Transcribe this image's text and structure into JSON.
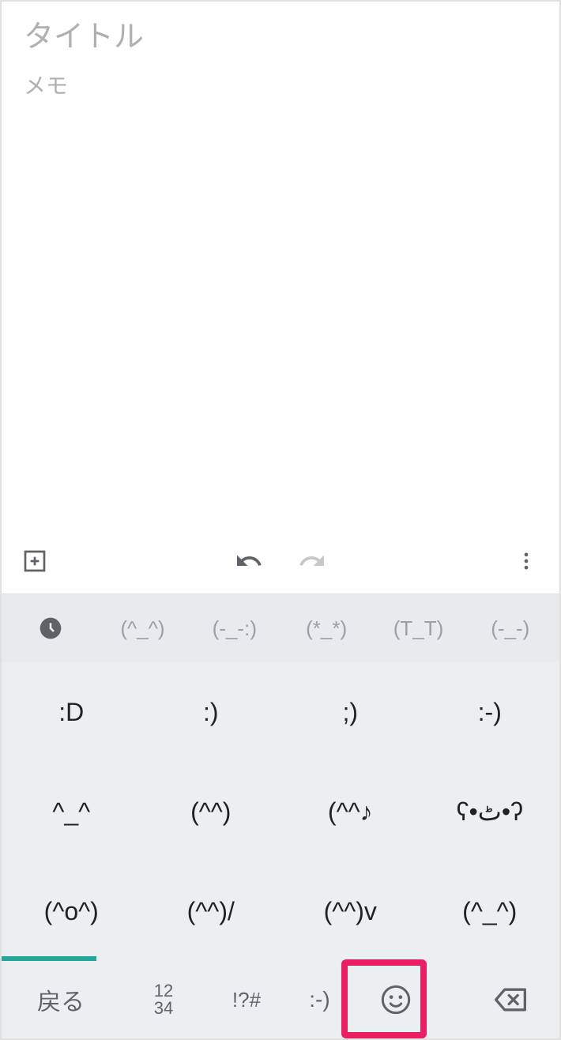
{
  "note": {
    "title_placeholder": "タイトル",
    "title_value": "",
    "memo_placeholder": "メモ",
    "memo_value": ""
  },
  "toolbar": {
    "add_label": "add",
    "undo_label": "undo",
    "redo_label": "redo",
    "more_label": "more"
  },
  "kaomoji_tabs": [
    {
      "type": "icon",
      "label": "recent"
    },
    {
      "type": "text",
      "label": "(^_^)"
    },
    {
      "type": "text",
      "label": "(-_-:)"
    },
    {
      "type": "text",
      "label": "(*_*)"
    },
    {
      "type": "text",
      "label": "(T_T)"
    },
    {
      "type": "text",
      "label": "(-_-)"
    }
  ],
  "kaomoji_grid": [
    [
      ":D",
      ":)",
      ";)",
      ":-)"
    ],
    [
      "^_^",
      "(^^)",
      "(^^♪",
      "ʕ•ٹ•ʔ"
    ],
    [
      "(^o^)",
      "(^^)/",
      "(^^)v",
      "(^_^)"
    ]
  ],
  "bottom_keys": {
    "back": "戻る",
    "nums_top": "12",
    "nums_bot": "34",
    "sym": "!?#",
    "face": ":-)"
  }
}
